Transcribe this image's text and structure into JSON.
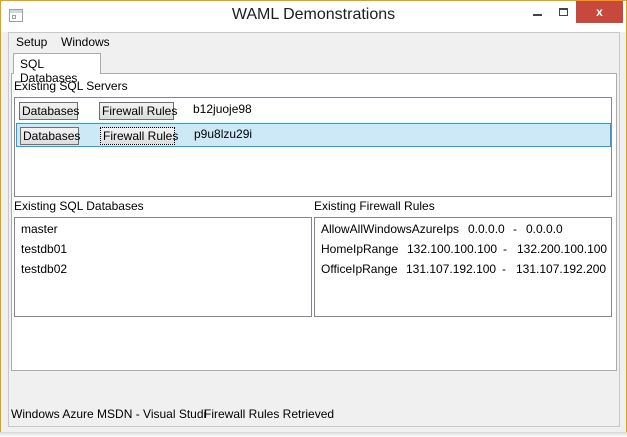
{
  "window": {
    "title": "WAML Demonstrations",
    "controls": {
      "minimize_icon": "minimize-icon",
      "maximize_icon": "maximize-icon",
      "close_glyph": "x"
    }
  },
  "menu": {
    "items": [
      {
        "label": "Setup"
      },
      {
        "label": "Windows"
      }
    ]
  },
  "tabs": [
    {
      "label": "SQL Databases",
      "selected": true
    }
  ],
  "servers": {
    "label": "Existing SQL Servers",
    "rows": [
      {
        "databases_label": "Databases",
        "firewall_label": "Firewall Rules",
        "name": "b12juoje98",
        "selected": false
      },
      {
        "databases_label": "Databases",
        "firewall_label": "Firewall Rules",
        "name": "p9u8lzu29i",
        "selected": true
      }
    ]
  },
  "databases": {
    "label": "Existing SQL Databases",
    "items": [
      "master",
      "testdb01",
      "testdb02"
    ]
  },
  "firewall": {
    "label": "Existing Firewall Rules",
    "rules": [
      {
        "name": "AllowAllWindowsAzureIps",
        "start": "0.0.0.0",
        "sep": "-",
        "end": "0.0.0.0"
      },
      {
        "name": "HomeIpRange",
        "start": "132.100.100.100",
        "sep": "-",
        "end": "132.200.100.100"
      },
      {
        "name": "OfficeIpRange",
        "start": "131.107.192.100",
        "sep": "-",
        "end": "131.107.192.200"
      }
    ]
  },
  "status": {
    "left": "Windows Azure MSDN - Visual Studi",
    "right": "Firewall Rules Retrieved"
  },
  "colors": {
    "selection_background": "#cde8f6",
    "selection_border": "#26a0da",
    "close_button": "#c7483d",
    "window_border": "#e8a200"
  }
}
